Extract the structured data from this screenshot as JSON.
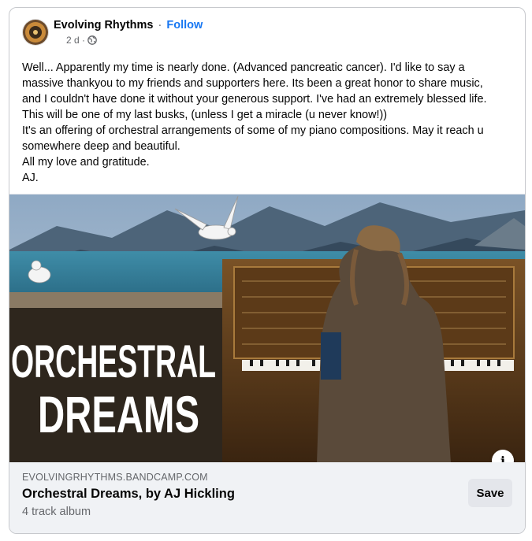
{
  "post": {
    "page_name": "Evolving Rhythms",
    "separator": "·",
    "follow_label": "Follow",
    "timestamp": "2 d ·",
    "body_lines": [
      "Well... Apparently my time is nearly done. (Advanced pancreatic cancer). I'd like to say a",
      "massive thankyou to my friends and supporters here. Its been a great honor to share music,",
      "and I couldn't have done it without your generous support. I've had an extremely blessed life.",
      "This will be one of my last busks, (unless I get a miracle (u never know!))",
      "It's an offering of orchestral arrangements of some of my piano compositions. May it reach u",
      "somewhere deep and beautiful.",
      "All my love and gratitude.",
      "AJ."
    ]
  },
  "media": {
    "album_art_line1": "ORCHESTRAL",
    "album_art_line2": "DREAMS",
    "info_icon": "i"
  },
  "link_preview": {
    "domain": "EVOLVINGRHYTHMS.BANDCAMP.COM",
    "title": "Orchestral Dreams, by AJ Hickling",
    "subtitle": "4 track album",
    "save_label": "Save"
  },
  "colors": {
    "accent": "#1877f2",
    "secondary_text": "#65676b",
    "link_bg": "#f0f2f5"
  }
}
